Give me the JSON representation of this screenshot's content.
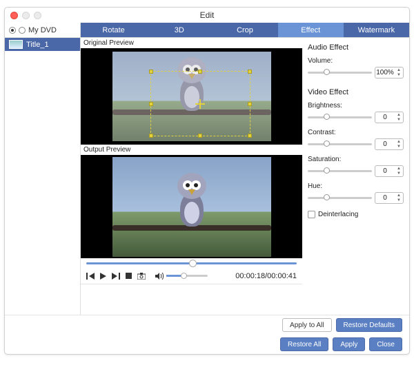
{
  "window": {
    "title": "Edit"
  },
  "tree": {
    "header": "My DVD",
    "item": "Title_1"
  },
  "tabs": {
    "rotate": "Rotate",
    "threeD": "3D",
    "crop": "Crop",
    "effect": "Effect",
    "watermark": "Watermark"
  },
  "preview": {
    "original": "Original Preview",
    "output": "Output Preview"
  },
  "playback": {
    "time": "00:00:18/00:00:41"
  },
  "audio": {
    "section": "Audio Effect",
    "volume_label": "Volume:",
    "volume_value": "100%"
  },
  "video": {
    "section": "Video Effect",
    "brightness_label": "Brightness:",
    "brightness_value": "0",
    "contrast_label": "Contrast:",
    "contrast_value": "0",
    "saturation_label": "Saturation:",
    "saturation_value": "0",
    "hue_label": "Hue:",
    "hue_value": "0",
    "deinterlace": "Deinterlacing"
  },
  "buttons": {
    "apply_all": "Apply to All",
    "restore_defaults": "Restore Defaults",
    "restore_all": "Restore All",
    "apply": "Apply",
    "close": "Close"
  }
}
